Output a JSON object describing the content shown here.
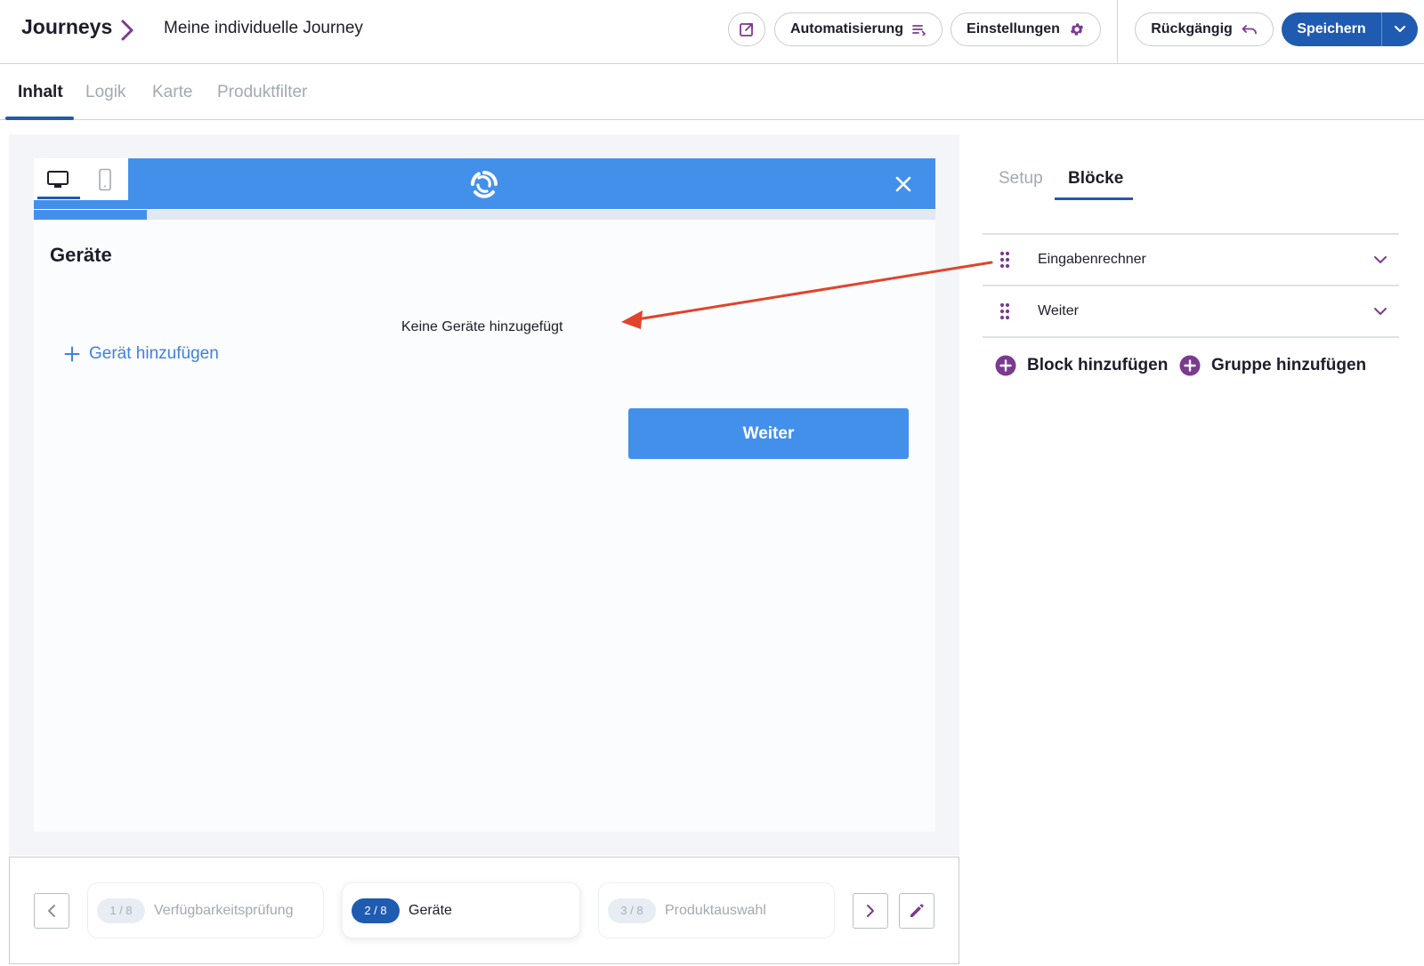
{
  "header": {
    "brand": "Journeys",
    "journey_name": "Meine individuelle Journey",
    "automation_label": "Automatisierung",
    "settings_label": "Einstellungen",
    "undo_label": "Rückgängig",
    "save_label": "Speichern"
  },
  "tabs": [
    {
      "label": "Inhalt",
      "active": true
    },
    {
      "label": "Logik",
      "active": false
    },
    {
      "label": "Karte",
      "active": false
    },
    {
      "label": "Produktfilter",
      "active": false
    }
  ],
  "preview": {
    "page_title": "Geräte",
    "empty_message": "Keine Geräte hinzugefügt",
    "add_device_label": "Gerät hinzufügen",
    "continue_label": "Weiter",
    "progress": 0.125
  },
  "steps": [
    {
      "badge": "1 / 8",
      "label": "Verfügbarkeitsprüfung",
      "current": false
    },
    {
      "badge": "2 / 8",
      "label": "Geräte",
      "current": true
    },
    {
      "badge": "3 / 8",
      "label": "Produktauswahl",
      "current": false
    }
  ],
  "side_panel": {
    "tabs": [
      {
        "label": "Setup",
        "active": false
      },
      {
        "label": "Blöcke",
        "active": true
      }
    ],
    "blocks": [
      {
        "name": "Eingabenrechner"
      },
      {
        "name": "Weiter"
      }
    ],
    "add_block_label": "Block hinzufügen",
    "add_group_label": "Gruppe hinzufügen"
  },
  "colors": {
    "primary": "#1f5bb0",
    "preview_accent": "#4390eb",
    "brand_purple": "#7a3b8f",
    "annotation_arrow": "#e0442b"
  },
  "icons": {
    "open": "external-link-icon",
    "automation": "list-icon",
    "settings": "gear-icon",
    "undo": "undo-icon",
    "save_menu": "chevron-down-icon",
    "desktop": "desktop-icon",
    "mobile": "mobile-icon",
    "close": "close-icon",
    "grip": "drag-handle-icon",
    "add": "plus-circle-icon"
  }
}
